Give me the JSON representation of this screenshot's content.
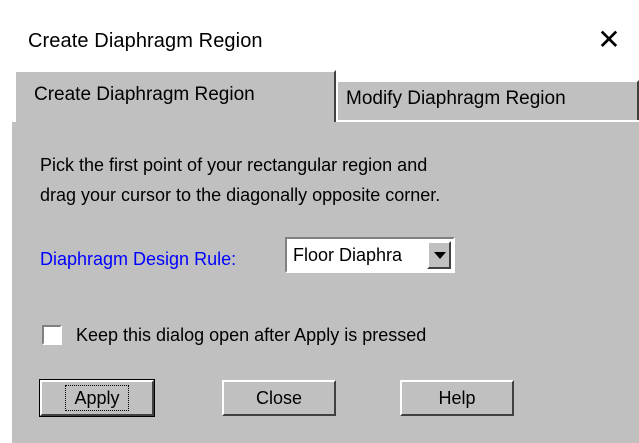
{
  "window": {
    "title": "Create Diaphragm Region",
    "close_glyph": "✕"
  },
  "tabs": [
    {
      "label": "Create Diaphragm Region",
      "active": true
    },
    {
      "label": "Modify Diaphragm Region",
      "active": false
    }
  ],
  "content": {
    "instruction_line1": "Pick the first point of your rectangular region and",
    "instruction_line2": "drag your cursor to the diagonally opposite corner.",
    "rule_label": "Diaphragm Design Rule:",
    "rule_value": "Floor Diaphra",
    "rule_label_color": "#0000ff",
    "keep_open_label": "Keep this dialog open after Apply is pressed",
    "keep_open_checked": false
  },
  "buttons": {
    "apply": "Apply",
    "close": "Close",
    "help": "Help"
  },
  "colors": {
    "panel": "#c0c0c0",
    "window": "#ffffff"
  }
}
